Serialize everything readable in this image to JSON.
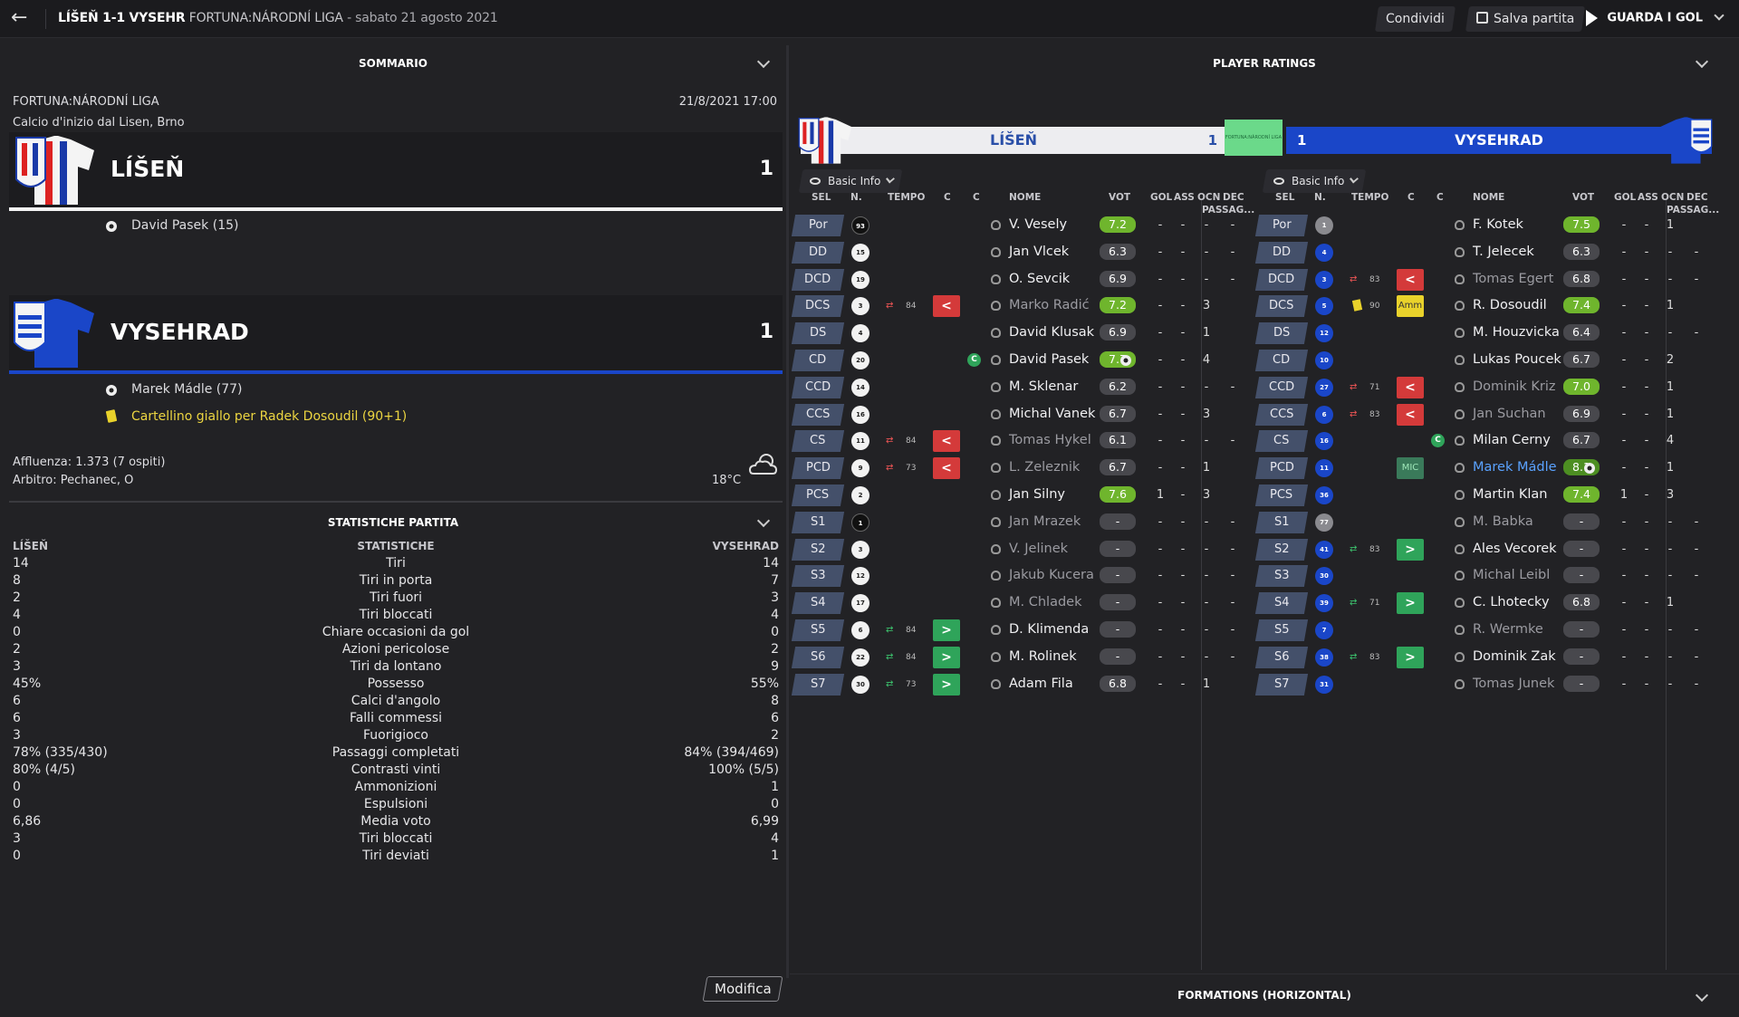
{
  "topbar": {
    "match": "LÍŠEŇ 1-1 VYSEHR",
    "league": "FORTUNA:NÁRODNÍ LIGA",
    "date": "- sabato 21 agosto 2021",
    "share": "Condividi",
    "save": "Salva partita",
    "watch": "GUARDA I GOL"
  },
  "summary": {
    "title": "SOMMARIO",
    "league": "FORTUNA:NÁRODNÍ LIGA",
    "datetime": "21/8/2021 17:00",
    "kickoff": "Calcio d'inizio dal Lisen, Brno",
    "home": {
      "name": "LÍŠEŇ",
      "score": "1",
      "color": "#ffffff"
    },
    "away": {
      "name": "VYSEHRAD",
      "score": "1",
      "color": "#1a46c8"
    },
    "home_events": [
      {
        "type": "goal-icon",
        "text": "David Pasek (15)"
      }
    ],
    "away_events": [
      {
        "type": "goal-icon",
        "text": "Marek Mádle (77)"
      },
      {
        "type": "yellow-card-icon",
        "text": "Cartellino giallo per Radek Dosoudil (90+1)"
      }
    ],
    "attendance": "Affluenza: 1.373 (7 ospiti)",
    "referee": "Arbitro: Pechanec, O",
    "temperature": "18°C"
  },
  "stats": {
    "title": "STATISTICHE PARTITA",
    "home_label": "LÍŠEŇ",
    "mid_label": "STATISTICHE",
    "away_label": "VYSEHRAD",
    "rows": [
      [
        "14",
        "Tiri",
        "14"
      ],
      [
        "8",
        "Tiri in porta",
        "7"
      ],
      [
        "2",
        "Tiri fuori",
        "3"
      ],
      [
        "4",
        "Tiri bloccati",
        "4"
      ],
      [
        "0",
        "Chiare occasioni da gol",
        "0"
      ],
      [
        "2",
        "Azioni pericolose",
        "2"
      ],
      [
        "3",
        "Tiri da lontano",
        "9"
      ],
      [
        "45%",
        "Possesso",
        "55%"
      ],
      [
        "6",
        "Calci d'angolo",
        "8"
      ],
      [
        "6",
        "Falli commessi",
        "6"
      ],
      [
        "3",
        "Fuorigioco",
        "2"
      ],
      [
        "78% (335/430)",
        "Passaggi completati",
        "84% (394/469)"
      ],
      [
        "80% (4/5)",
        "Contrasti vinti",
        "100% (5/5)"
      ],
      [
        "0",
        "Ammonizioni",
        "1"
      ],
      [
        "0",
        "Espulsioni",
        "0"
      ],
      [
        "6,86",
        "Media voto",
        "6,99"
      ],
      [
        "3",
        "Tiri bloccati",
        "4"
      ],
      [
        "0",
        "Tiri deviati",
        "1"
      ]
    ],
    "edit": "Modifica"
  },
  "ratings": {
    "title": "PLAYER RATINGS",
    "home_name": "LÍŠEŇ",
    "home_score": "1",
    "away_name": "VYSEHRAD",
    "away_score": "1",
    "filter": "Basic Info",
    "group_label": "PASSAG...",
    "cols": [
      "SEL",
      "N.",
      "TEMPO",
      "C",
      "C",
      "NOME",
      "VOT",
      "GOL",
      "ASS",
      "OCN",
      "DEC"
    ],
    "home_players": [
      {
        "pos": "Por",
        "n": "93",
        "kit": "dark",
        "name": "V. Vesely",
        "r": "7.2",
        "rc": "g",
        "gol": "-",
        "ass": "-",
        "ocn": "-",
        "dec": "-"
      },
      {
        "pos": "DD",
        "n": "15",
        "name": "Jan Vlcek",
        "r": "6.3",
        "gol": "-",
        "ass": "-",
        "ocn": "-",
        "dec": "-"
      },
      {
        "pos": "DCD",
        "n": "19",
        "name": "O. Sevcik",
        "r": "6.9",
        "gol": "-",
        "ass": "-",
        "ocn": "-",
        "dec": "-"
      },
      {
        "pos": "DCS",
        "n": "3",
        "sub": "out",
        "min": "84",
        "name": "Marko Radić",
        "dim": true,
        "r": "7.2",
        "rc": "g",
        "gol": "-",
        "ass": "-",
        "ocn": "3",
        "dec": ""
      },
      {
        "pos": "DS",
        "n": "4",
        "name": "David Klusak",
        "r": "6.9",
        "gol": "-",
        "ass": "-",
        "ocn": "1",
        "dec": ""
      },
      {
        "pos": "CD",
        "n": "20",
        "cap": true,
        "name": "David Pasek",
        "r": "7.7",
        "rc": "g",
        "ball": true,
        "gol": "-",
        "ass": "-",
        "ocn": "4",
        "dec": ""
      },
      {
        "pos": "CCD",
        "n": "14",
        "name": "M. Sklenar",
        "r": "6.2",
        "gol": "-",
        "ass": "-",
        "ocn": "-",
        "dec": "-"
      },
      {
        "pos": "CCS",
        "n": "16",
        "name": "Michal Vanek",
        "r": "6.7",
        "gol": "-",
        "ass": "-",
        "ocn": "3",
        "dec": ""
      },
      {
        "pos": "CS",
        "n": "11",
        "sub": "out",
        "min": "84",
        "name": "Tomas Hykel",
        "dim": true,
        "r": "6.1",
        "gol": "-",
        "ass": "-",
        "ocn": "-",
        "dec": "-"
      },
      {
        "pos": "PCD",
        "n": "9",
        "sub": "out",
        "min": "73",
        "name": "L. Zeleznik",
        "dim": true,
        "r": "6.7",
        "gol": "-",
        "ass": "-",
        "ocn": "1",
        "dec": ""
      },
      {
        "pos": "PCS",
        "n": "2",
        "name": "Jan Silny",
        "r": "7.6",
        "rc": "g",
        "gol": "1",
        "ass": "-",
        "ocn": "3",
        "dec": ""
      },
      {
        "pos": "S1",
        "n": "1",
        "kit": "dark",
        "name": "Jan Mrazek",
        "dim": true,
        "r": "-",
        "gol": "-",
        "ass": "-",
        "ocn": "-",
        "dec": "-"
      },
      {
        "pos": "S2",
        "n": "3",
        "name": "V. Jelinek",
        "dim": true,
        "r": "-",
        "gol": "-",
        "ass": "-",
        "ocn": "-",
        "dec": "-"
      },
      {
        "pos": "S3",
        "n": "12",
        "name": "Jakub Kucera",
        "dim": true,
        "r": "-",
        "gol": "-",
        "ass": "-",
        "ocn": "-",
        "dec": "-"
      },
      {
        "pos": "S4",
        "n": "17",
        "name": "M. Chladek",
        "dim": true,
        "r": "-",
        "gol": "-",
        "ass": "-",
        "ocn": "-",
        "dec": "-"
      },
      {
        "pos": "S5",
        "n": "6",
        "sub": "in",
        "min": "84",
        "name": "D. Klimenda",
        "r": "-",
        "gol": "-",
        "ass": "-",
        "ocn": "-",
        "dec": "-"
      },
      {
        "pos": "S6",
        "n": "22",
        "sub": "in",
        "min": "84",
        "name": "M. Rolinek",
        "r": "-",
        "gol": "-",
        "ass": "-",
        "ocn": "-",
        "dec": "-"
      },
      {
        "pos": "S7",
        "n": "30",
        "sub": "in",
        "min": "73",
        "name": "Adam Fila",
        "r": "6.8",
        "gol": "-",
        "ass": "-",
        "ocn": "1",
        "dec": ""
      }
    ],
    "away_players": [
      {
        "pos": "Por",
        "n": "1",
        "kit": "gray",
        "name": "F. Kotek",
        "r": "7.5",
        "rc": "g",
        "gol": "-",
        "ass": "-",
        "ocn": "1",
        "dec": ""
      },
      {
        "pos": "DD",
        "n": "4",
        "name": "T. Jelecek",
        "r": "6.3",
        "gol": "-",
        "ass": "-",
        "ocn": "-",
        "dec": "-"
      },
      {
        "pos": "DCD",
        "n": "3",
        "sub": "out",
        "min": "83",
        "name": "Tomas Egert",
        "dim": true,
        "r": "6.8",
        "gol": "-",
        "ass": "-",
        "ocn": "-",
        "dec": "-"
      },
      {
        "pos": "DCS",
        "n": "5",
        "card": "amm",
        "min": "90",
        "name": "R. Dosoudil",
        "r": "7.4",
        "rc": "g",
        "gol": "-",
        "ass": "-",
        "ocn": "1",
        "dec": ""
      },
      {
        "pos": "DS",
        "n": "12",
        "name": "M. Houzvicka",
        "r": "6.4",
        "gol": "-",
        "ass": "-",
        "ocn": "-",
        "dec": "-"
      },
      {
        "pos": "CD",
        "n": "10",
        "name": "Lukas Poucek",
        "r": "6.7",
        "gol": "-",
        "ass": "-",
        "ocn": "2",
        "dec": ""
      },
      {
        "pos": "CCD",
        "n": "27",
        "sub": "out",
        "min": "71",
        "name": "Dominik Kriz",
        "dim": true,
        "r": "7.0",
        "rc": "g",
        "gol": "-",
        "ass": "-",
        "ocn": "1",
        "dec": ""
      },
      {
        "pos": "CCS",
        "n": "6",
        "sub": "out",
        "min": "83",
        "name": "Jan Suchan",
        "dim": true,
        "r": "6.9",
        "gol": "-",
        "ass": "-",
        "ocn": "1",
        "dec": ""
      },
      {
        "pos": "CS",
        "n": "16",
        "cap": true,
        "name": "Milan Cerny",
        "r": "6.7",
        "gol": "-",
        "ass": "-",
        "ocn": "4",
        "dec": ""
      },
      {
        "pos": "PCD",
        "n": "11",
        "mic": true,
        "name": "Marek Mádle",
        "hl": true,
        "r": "8.1",
        "rc": "gd",
        "ball": true,
        "gol": "-",
        "ass": "-",
        "ocn": "1",
        "dec": ""
      },
      {
        "pos": "PCS",
        "n": "36",
        "name": "Martin Klan",
        "r": "7.4",
        "rc": "g",
        "gol": "1",
        "ass": "-",
        "ocn": "3",
        "dec": ""
      },
      {
        "pos": "S1",
        "n": "77",
        "kit": "gray",
        "name": "M. Babka",
        "dim": true,
        "r": "-",
        "gol": "-",
        "ass": "-",
        "ocn": "-",
        "dec": "-"
      },
      {
        "pos": "S2",
        "n": "41",
        "sub": "in",
        "min": "83",
        "name": "Ales Vecorek",
        "r": "-",
        "gol": "-",
        "ass": "-",
        "ocn": "-",
        "dec": "-"
      },
      {
        "pos": "S3",
        "n": "30",
        "name": "Michal Leibl",
        "dim": true,
        "r": "-",
        "gol": "-",
        "ass": "-",
        "ocn": "-",
        "dec": "-"
      },
      {
        "pos": "S4",
        "n": "39",
        "sub": "in",
        "min": "71",
        "name": "C. Lhotecky",
        "r": "6.8",
        "gol": "-",
        "ass": "-",
        "ocn": "1",
        "dec": ""
      },
      {
        "pos": "S5",
        "n": "7",
        "name": "R. Wermke",
        "dim": true,
        "r": "-",
        "gol": "-",
        "ass": "-",
        "ocn": "-",
        "dec": "-"
      },
      {
        "pos": "S6",
        "n": "38",
        "sub": "in",
        "min": "83",
        "name": "Dominik Zak",
        "r": "-",
        "gol": "-",
        "ass": "-",
        "ocn": "-",
        "dec": "-"
      },
      {
        "pos": "S7",
        "n": "31",
        "name": "Tomas Junek",
        "dim": true,
        "r": "-",
        "gol": "-",
        "ass": "-",
        "ocn": "-",
        "dec": "-"
      }
    ],
    "formations": "FORMATIONS (HORIZONTAL)"
  }
}
